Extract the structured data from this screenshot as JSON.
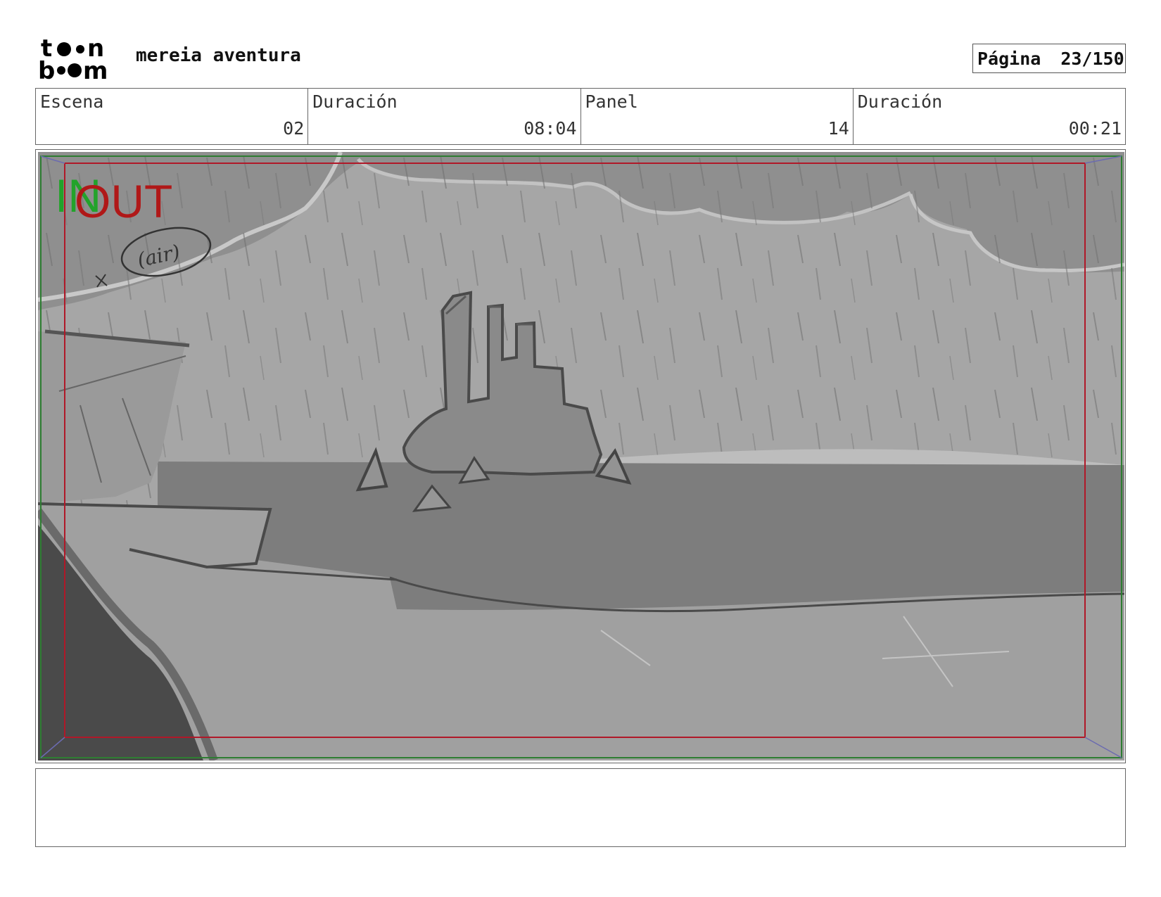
{
  "header": {
    "logo_text": "toon boom",
    "project_title": "mereia aventura",
    "page_label": "Página",
    "page_number": "23/150"
  },
  "info": {
    "scene_label": "Escena",
    "scene_value": "02",
    "scene_duration_label": "Duración",
    "scene_duration_value": "08:04",
    "panel_label": "Panel",
    "panel_value": "14",
    "panel_duration_label": "Duración",
    "panel_duration_value": "00:21"
  },
  "panel": {
    "in_label": "IN",
    "out_label": "OUT",
    "sketch_note": "(air)",
    "colors": {
      "in_marker": "#22a32a",
      "out_marker": "#b01818",
      "safe_frame": "#b01828",
      "camera_frame": "#2e7d32"
    }
  },
  "notes": {
    "text": ""
  }
}
